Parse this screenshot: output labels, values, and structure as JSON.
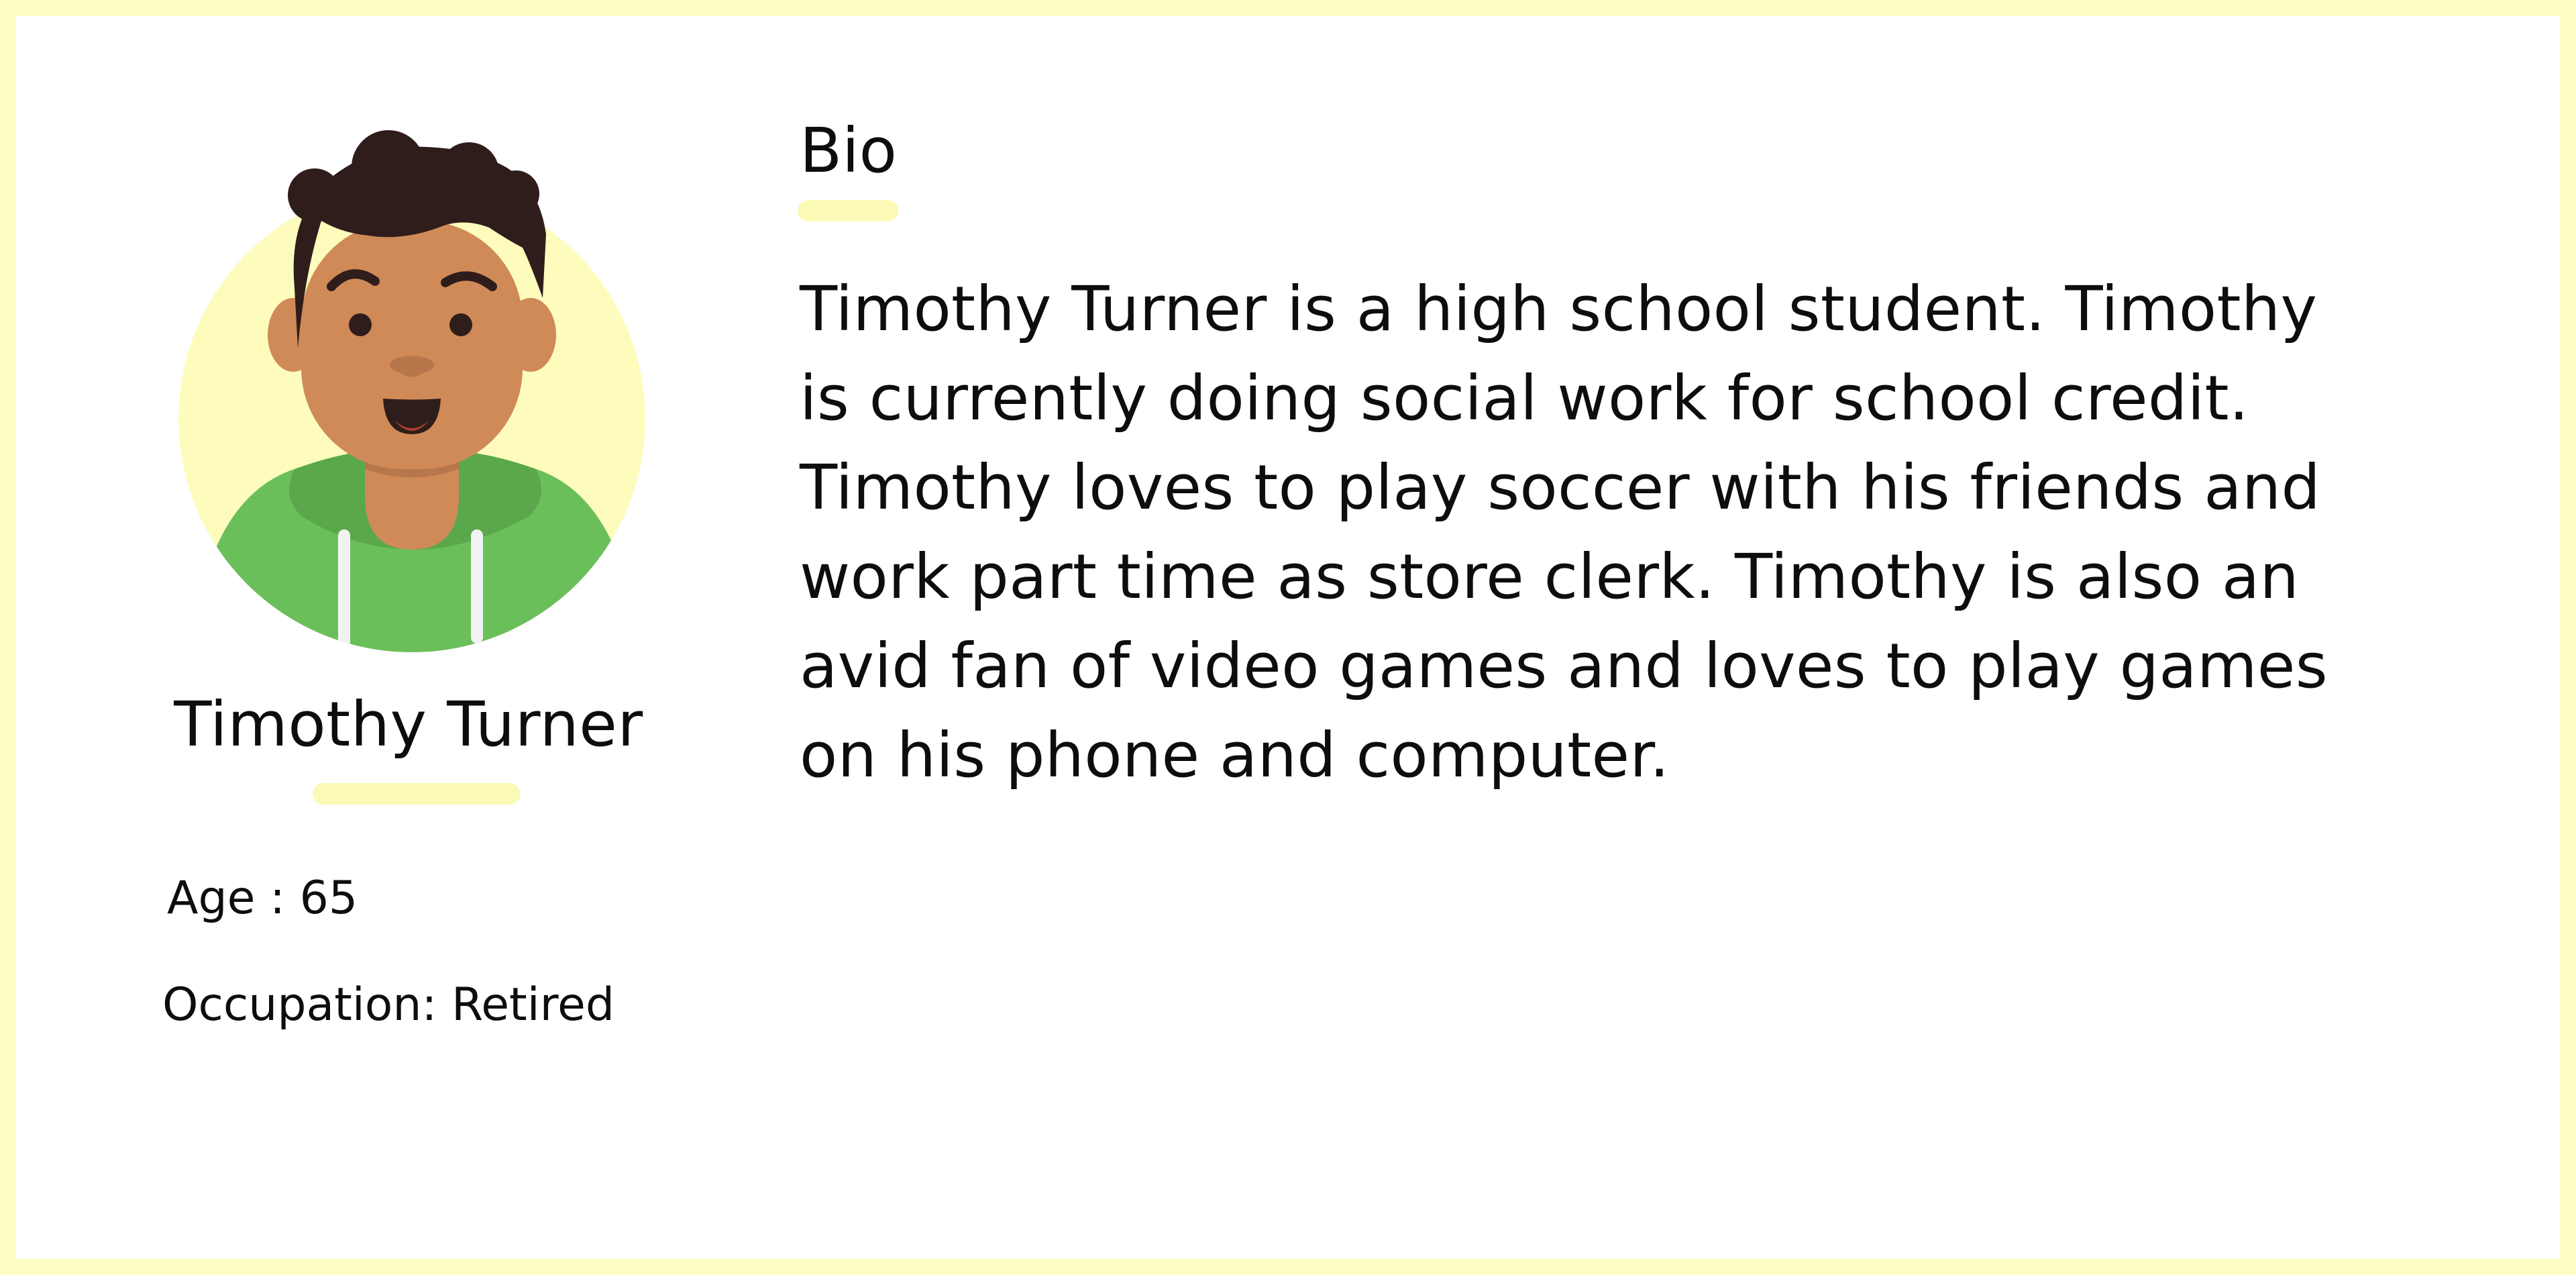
{
  "profile": {
    "name": "Timothy Turner",
    "age_line": "Age : 65",
    "occupation_line": "Occupation: Retired"
  },
  "bio": {
    "heading": "Bio",
    "text": "Timothy Turner is a high school student. Timothy is currently doing social work for school credit. Timothy loves to play soccer with his friends and work part time as store clerk. Timothy is also an avid fan of video games and loves to play games on his phone and computer."
  },
  "colors": {
    "frame": "#fdfdc4",
    "accent": "#fbf9b6",
    "text": "#0d0d0d",
    "avatar_circle": "#fdfcbd",
    "skin": "#cf8a58",
    "hair": "#2f1d1b",
    "hoodie": "#6abf5a"
  },
  "icons": {
    "avatar": "person-avatar-icon"
  }
}
